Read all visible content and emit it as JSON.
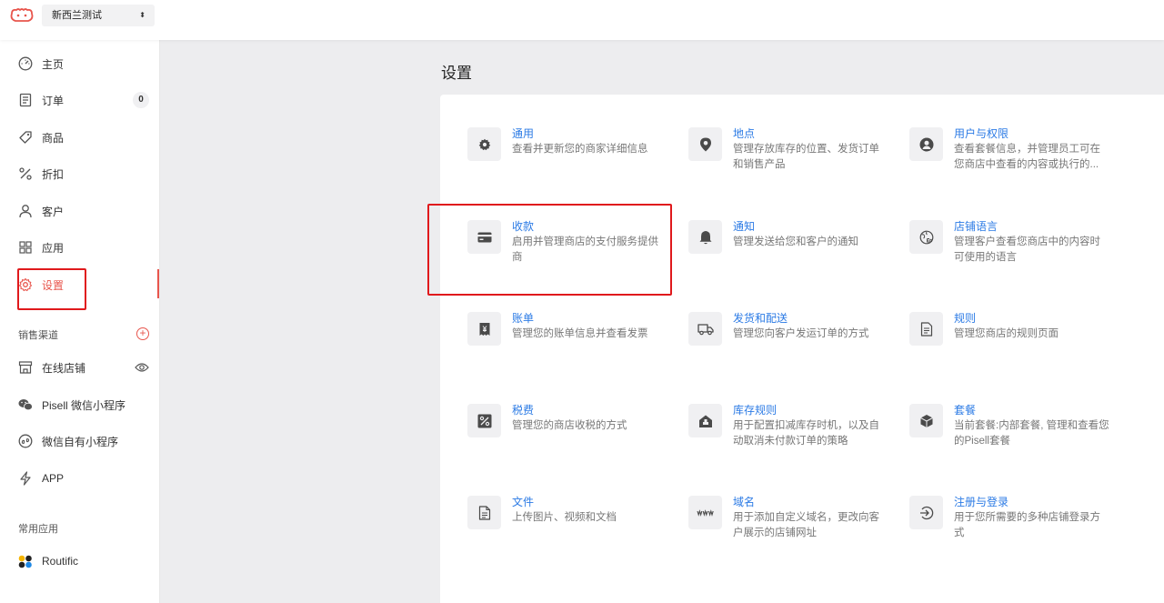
{
  "topbar": {
    "store_name": "新西兰测试",
    "caret": "⬍"
  },
  "sidebar": {
    "items": [
      {
        "label": "主页"
      },
      {
        "label": "订单",
        "badge": "0"
      },
      {
        "label": "商品"
      },
      {
        "label": "折扣"
      },
      {
        "label": "客户"
      },
      {
        "label": "应用"
      },
      {
        "label": "设置"
      }
    ],
    "sales_channels": {
      "title": "销售渠道",
      "add_icon": "+",
      "items": [
        {
          "label": "在线店铺"
        },
        {
          "label": "Pisell 微信小程序"
        },
        {
          "label": "微信自有小程序"
        },
        {
          "label": "APP"
        }
      ]
    },
    "common_apps": {
      "title": "常用应用",
      "items": [
        {
          "label": "Routific"
        }
      ]
    }
  },
  "main": {
    "title": "设置",
    "cards": [
      {
        "title": "通用",
        "desc": "查看并更新您的商家详细信息"
      },
      {
        "title": "地点",
        "desc": "管理存放库存的位置、发货订单和销售产品"
      },
      {
        "title": "用户与权限",
        "desc": "查看套餐信息，并管理员工可在您商店中查看的内容或执行的..."
      },
      {
        "title": "收款",
        "desc": "启用并管理商店的支付服务提供商"
      },
      {
        "title": "通知",
        "desc": "管理发送给您和客户的通知"
      },
      {
        "title": "店铺语言",
        "desc": "管理客户查看您商店中的内容时可使用的语言"
      },
      {
        "title": "账单",
        "desc": "管理您的账单信息并查看发票"
      },
      {
        "title": "发货和配送",
        "desc": "管理您向客户发运订单的方式"
      },
      {
        "title": "规则",
        "desc": "管理您商店的规则页面"
      },
      {
        "title": "税费",
        "desc": "管理您的商店收税的方式"
      },
      {
        "title": "库存规则",
        "desc": "用于配置扣减库存时机，以及自动取消未付款订单的策略"
      },
      {
        "title": "套餐",
        "desc": "当前套餐:内部套餐, 管理和查看您的Pisell套餐"
      },
      {
        "title": "文件",
        "desc": "上传图片、视频和文档"
      },
      {
        "title": "域名",
        "desc": "用于添加自定义域名，更改向客户展示的店铺网址"
      },
      {
        "title": "注册与登录",
        "desc": "用于您所需要的多种店铺登录方式"
      }
    ]
  },
  "colors": {
    "accent": "#e8554c",
    "link": "#2c7be5",
    "highlight": "#e0191c"
  }
}
